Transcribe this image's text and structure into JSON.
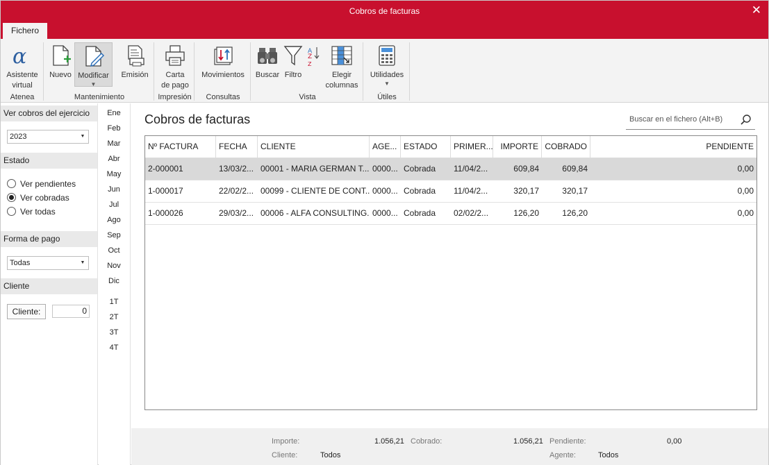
{
  "window": {
    "title": "Cobros de facturas",
    "close_glyph": "✕"
  },
  "tabs": [
    {
      "label": "Fichero"
    }
  ],
  "ribbon": {
    "groups": {
      "atenea": "Atenea",
      "mantenimiento": "Mantenimiento",
      "impresion": "Impresión",
      "consultas": "Consultas",
      "vista": "Vista",
      "utiles": "Útiles"
    },
    "buttons": {
      "asistente_l1": "Asistente",
      "asistente_l2": "virtual",
      "nuevo": "Nuevo",
      "modificar": "Modificar",
      "emision": "Emisión",
      "carta_l1": "Carta",
      "carta_l2": "de pago",
      "movimientos": "Movimientos",
      "buscar": "Buscar",
      "filtro": "Filtro",
      "elegir_l1": "Elegir",
      "elegir_l2": "columnas",
      "utilidades": "Utilidades"
    }
  },
  "filters": {
    "ejercicio_header": "Ver cobros del ejercicio",
    "ejercicio_value": "2023",
    "estado_header": "Estado",
    "estado_options": [
      {
        "label": "Ver pendientes",
        "selected": false
      },
      {
        "label": "Ver cobradas",
        "selected": true
      },
      {
        "label": "Ver todas",
        "selected": false
      }
    ],
    "forma_header": "Forma de pago",
    "forma_value": "Todas",
    "cliente_header": "Cliente",
    "cliente_button": "Cliente:",
    "cliente_value": "0"
  },
  "months": [
    "Ene",
    "Feb",
    "Mar",
    "Abr",
    "May",
    "Jun",
    "Jul",
    "Ago",
    "Sep",
    "Oct",
    "Nov",
    "Dic"
  ],
  "quarters": [
    "1T",
    "2T",
    "3T",
    "4T"
  ],
  "main": {
    "heading": "Cobros de facturas",
    "search_placeholder": "Buscar en el fichero (Alt+B)"
  },
  "table": {
    "columns": [
      "Nº FACTURA",
      "FECHA",
      "CLIENTE",
      "AGE...",
      "ESTADO",
      "PRIMER...",
      "IMPORTE",
      "COBRADO",
      "PENDIENTE"
    ],
    "rows": [
      [
        "2-000001",
        "13/03/2...",
        "00001 - MARIA GERMAN T...",
        "0000...",
        "Cobrada",
        "11/04/2...",
        "609,84",
        "609,84",
        "0,00"
      ],
      [
        "1-000017",
        "22/02/2...",
        "00099 - CLIENTE DE CONT...",
        "0000...",
        "Cobrada",
        "11/04/2...",
        "320,17",
        "320,17",
        "0,00"
      ],
      [
        "1-000026",
        "29/03/2...",
        "00006 - ALFA CONSULTING...",
        "0000...",
        "Cobrada",
        "02/02/2...",
        "126,20",
        "126,20",
        "0,00"
      ]
    ],
    "selected_row": 0
  },
  "footer": {
    "importe_label": "Importe:",
    "importe_value": "1.056,21",
    "cobrado_label": "Cobrado:",
    "cobrado_value": "1.056,21",
    "pendiente_label": "Pendiente:",
    "pendiente_value": "0,00",
    "cliente_label": "Cliente:",
    "cliente_value": "Todos",
    "agente_label": "Agente:",
    "agente_value": "Todos"
  },
  "colors": {
    "accent": "#c8102e",
    "selection": "#d9d9d9",
    "ribbon_bg": "#f3f3f3"
  }
}
